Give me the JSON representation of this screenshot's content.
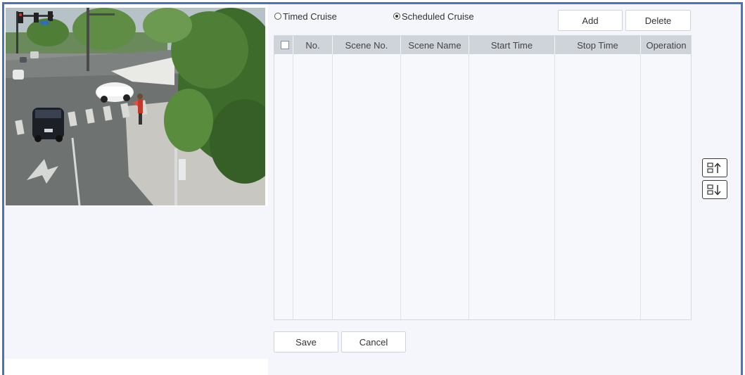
{
  "cruise_mode": {
    "timed_label": "Timed Cruise",
    "scheduled_label": "Scheduled Cruise",
    "selected": "Scheduled Cruise"
  },
  "toolbar": {
    "add_label": "Add",
    "delete_label": "Delete"
  },
  "table": {
    "columns": [
      "No.",
      "Scene No.",
      "Scene Name",
      "Start Time",
      "Stop Time",
      "Operation"
    ],
    "rows": []
  },
  "footer": {
    "save_label": "Save",
    "cancel_label": "Cancel"
  },
  "side_controls": {
    "move_up_icon": "move-up-icon",
    "move_down_icon": "move-down-icon"
  },
  "colors": {
    "frame_border": "#4a72c4",
    "panel_background": "#f4f6fb",
    "table_header": "#cfd3da"
  }
}
